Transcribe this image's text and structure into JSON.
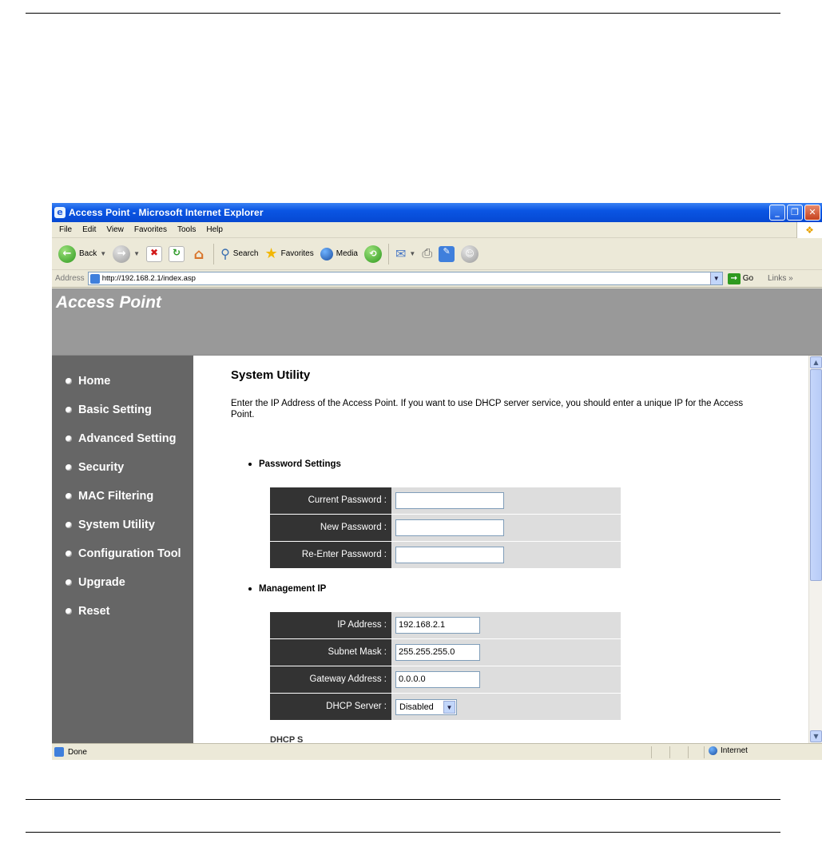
{
  "window": {
    "title": "Access Point - Microsoft Internet Explorer",
    "controls": {
      "minimize": "_",
      "maximize": "❐",
      "close": "✕"
    }
  },
  "menu": [
    "File",
    "Edit",
    "View",
    "Favorites",
    "Tools",
    "Help"
  ],
  "toolbar": {
    "back": "Back",
    "search": "Search",
    "favorites": "Favorites",
    "media": "Media"
  },
  "address": {
    "label": "Address",
    "url": "http://192.168.2.1/index.asp",
    "go": "Go",
    "links": "Links"
  },
  "page": {
    "brand": "Access Point",
    "nav": [
      "Home",
      "Basic Setting",
      "Advanced Setting",
      "Security",
      "MAC Filtering",
      "System Utility",
      "Configuration Tool",
      "Upgrade",
      "Reset"
    ],
    "title": "System Utility",
    "intro": "Enter the IP Address of the Access Point. If you want to use DHCP server service, you should enter a unique IP for the Access Point.",
    "password_section": {
      "heading": "Password Settings",
      "current_label": "Current Password :",
      "current_value": "",
      "new_label": "New Password :",
      "new_value": "",
      "reenter_label": "Re-Enter Password :",
      "reenter_value": ""
    },
    "management_section": {
      "heading": "Management IP",
      "ip_label": "IP Address :",
      "ip_value": "192.168.2.1",
      "mask_label": "Subnet Mask :",
      "mask_value": "255.255.255.0",
      "gateway_label": "Gateway Address :",
      "gateway_value": "0.0.0.0",
      "dhcp_label": "DHCP Server :",
      "dhcp_value": "Disabled"
    },
    "cut_heading": "DHCP S"
  },
  "status": {
    "text": "Done",
    "zone": "Internet"
  }
}
